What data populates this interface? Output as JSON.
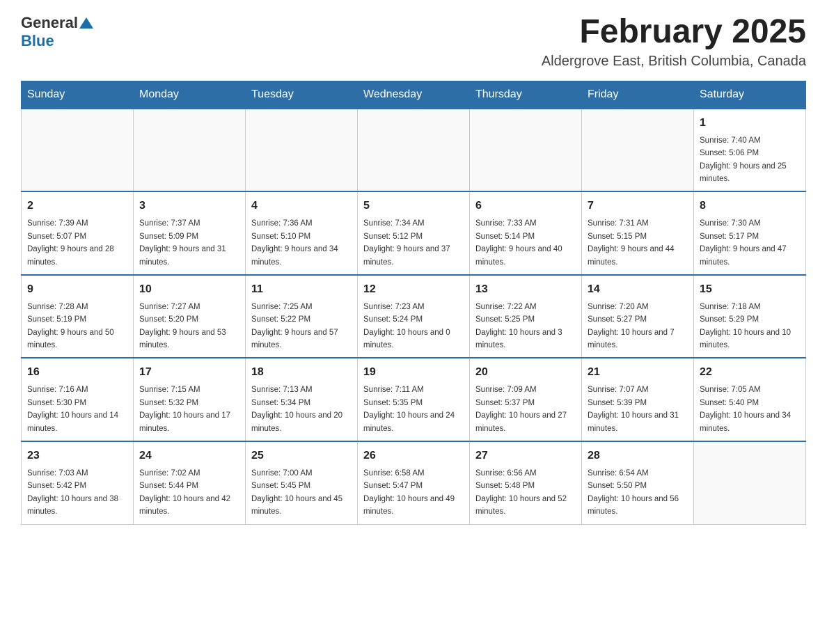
{
  "logo": {
    "general": "General",
    "blue": "Blue"
  },
  "title": "February 2025",
  "location": "Aldergrove East, British Columbia, Canada",
  "days_of_week": [
    "Sunday",
    "Monday",
    "Tuesday",
    "Wednesday",
    "Thursday",
    "Friday",
    "Saturday"
  ],
  "weeks": [
    [
      {
        "day": "",
        "info": ""
      },
      {
        "day": "",
        "info": ""
      },
      {
        "day": "",
        "info": ""
      },
      {
        "day": "",
        "info": ""
      },
      {
        "day": "",
        "info": ""
      },
      {
        "day": "",
        "info": ""
      },
      {
        "day": "1",
        "info": "Sunrise: 7:40 AM\nSunset: 5:06 PM\nDaylight: 9 hours and 25 minutes."
      }
    ],
    [
      {
        "day": "2",
        "info": "Sunrise: 7:39 AM\nSunset: 5:07 PM\nDaylight: 9 hours and 28 minutes."
      },
      {
        "day": "3",
        "info": "Sunrise: 7:37 AM\nSunset: 5:09 PM\nDaylight: 9 hours and 31 minutes."
      },
      {
        "day": "4",
        "info": "Sunrise: 7:36 AM\nSunset: 5:10 PM\nDaylight: 9 hours and 34 minutes."
      },
      {
        "day": "5",
        "info": "Sunrise: 7:34 AM\nSunset: 5:12 PM\nDaylight: 9 hours and 37 minutes."
      },
      {
        "day": "6",
        "info": "Sunrise: 7:33 AM\nSunset: 5:14 PM\nDaylight: 9 hours and 40 minutes."
      },
      {
        "day": "7",
        "info": "Sunrise: 7:31 AM\nSunset: 5:15 PM\nDaylight: 9 hours and 44 minutes."
      },
      {
        "day": "8",
        "info": "Sunrise: 7:30 AM\nSunset: 5:17 PM\nDaylight: 9 hours and 47 minutes."
      }
    ],
    [
      {
        "day": "9",
        "info": "Sunrise: 7:28 AM\nSunset: 5:19 PM\nDaylight: 9 hours and 50 minutes."
      },
      {
        "day": "10",
        "info": "Sunrise: 7:27 AM\nSunset: 5:20 PM\nDaylight: 9 hours and 53 minutes."
      },
      {
        "day": "11",
        "info": "Sunrise: 7:25 AM\nSunset: 5:22 PM\nDaylight: 9 hours and 57 minutes."
      },
      {
        "day": "12",
        "info": "Sunrise: 7:23 AM\nSunset: 5:24 PM\nDaylight: 10 hours and 0 minutes."
      },
      {
        "day": "13",
        "info": "Sunrise: 7:22 AM\nSunset: 5:25 PM\nDaylight: 10 hours and 3 minutes."
      },
      {
        "day": "14",
        "info": "Sunrise: 7:20 AM\nSunset: 5:27 PM\nDaylight: 10 hours and 7 minutes."
      },
      {
        "day": "15",
        "info": "Sunrise: 7:18 AM\nSunset: 5:29 PM\nDaylight: 10 hours and 10 minutes."
      }
    ],
    [
      {
        "day": "16",
        "info": "Sunrise: 7:16 AM\nSunset: 5:30 PM\nDaylight: 10 hours and 14 minutes."
      },
      {
        "day": "17",
        "info": "Sunrise: 7:15 AM\nSunset: 5:32 PM\nDaylight: 10 hours and 17 minutes."
      },
      {
        "day": "18",
        "info": "Sunrise: 7:13 AM\nSunset: 5:34 PM\nDaylight: 10 hours and 20 minutes."
      },
      {
        "day": "19",
        "info": "Sunrise: 7:11 AM\nSunset: 5:35 PM\nDaylight: 10 hours and 24 minutes."
      },
      {
        "day": "20",
        "info": "Sunrise: 7:09 AM\nSunset: 5:37 PM\nDaylight: 10 hours and 27 minutes."
      },
      {
        "day": "21",
        "info": "Sunrise: 7:07 AM\nSunset: 5:39 PM\nDaylight: 10 hours and 31 minutes."
      },
      {
        "day": "22",
        "info": "Sunrise: 7:05 AM\nSunset: 5:40 PM\nDaylight: 10 hours and 34 minutes."
      }
    ],
    [
      {
        "day": "23",
        "info": "Sunrise: 7:03 AM\nSunset: 5:42 PM\nDaylight: 10 hours and 38 minutes."
      },
      {
        "day": "24",
        "info": "Sunrise: 7:02 AM\nSunset: 5:44 PM\nDaylight: 10 hours and 42 minutes."
      },
      {
        "day": "25",
        "info": "Sunrise: 7:00 AM\nSunset: 5:45 PM\nDaylight: 10 hours and 45 minutes."
      },
      {
        "day": "26",
        "info": "Sunrise: 6:58 AM\nSunset: 5:47 PM\nDaylight: 10 hours and 49 minutes."
      },
      {
        "day": "27",
        "info": "Sunrise: 6:56 AM\nSunset: 5:48 PM\nDaylight: 10 hours and 52 minutes."
      },
      {
        "day": "28",
        "info": "Sunrise: 6:54 AM\nSunset: 5:50 PM\nDaylight: 10 hours and 56 minutes."
      },
      {
        "day": "",
        "info": ""
      }
    ]
  ]
}
